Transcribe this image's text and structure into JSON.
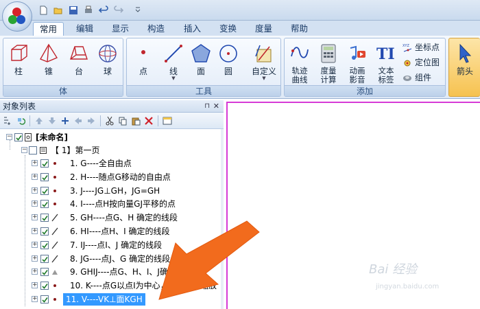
{
  "quick_access": [
    "new-icon",
    "open-icon",
    "save-icon",
    "print-icon",
    "undo-icon",
    "redo-icon",
    "customize-icon"
  ],
  "tabs": [
    {
      "label": "常用",
      "active": true
    },
    {
      "label": "编辑"
    },
    {
      "label": "显示"
    },
    {
      "label": "构造"
    },
    {
      "label": "插入"
    },
    {
      "label": "变换"
    },
    {
      "label": "度量"
    },
    {
      "label": "帮助"
    }
  ],
  "ribbon": {
    "solid_group": {
      "label": "体",
      "buttons": [
        "柱",
        "锥",
        "台",
        "球"
      ]
    },
    "tool_group": {
      "label": "工具",
      "buttons": [
        "点",
        "线",
        "面",
        "圆"
      ],
      "custom": "自定义"
    },
    "add_group": {
      "label": "添加",
      "buttons": [
        [
          "轨迹",
          "曲线"
        ],
        [
          "度量",
          "计算"
        ],
        [
          "动画",
          "影音"
        ],
        [
          "文本",
          "标签"
        ]
      ],
      "small": [
        "坐标点",
        "定位图",
        "组件"
      ]
    },
    "arrow_button": "箭头"
  },
  "panel": {
    "title": "对象列表",
    "root": "[未命名]",
    "page": "【 1】第一页",
    "items": [
      {
        "text": "1. G----全自由点",
        "icon": "point"
      },
      {
        "text": "2. H----随点G移动的自由点",
        "icon": "point"
      },
      {
        "text": "3. J----JG⊥GH，JG=GH",
        "icon": "point"
      },
      {
        "text": "4. I----点H按向量GJ平移的点",
        "icon": "point"
      },
      {
        "text": "5. GH----点G、H 确定的线段",
        "icon": "segment"
      },
      {
        "text": "6. HI----点H、I 确定的线段",
        "icon": "segment"
      },
      {
        "text": "7. IJ----点I、J 确定的线段",
        "icon": "segment"
      },
      {
        "text": "8. JG----点J、G 确定的线段",
        "icon": "segment"
      },
      {
        "text": "9. GHIJ----点G、H、I、J确定",
        "icon": "polygon"
      },
      {
        "text": "10. K----点G以点I为中心，按.5000缩放",
        "icon": "point"
      },
      {
        "text": "11. V----VK⊥面KGH",
        "icon": "point",
        "selected": true
      }
    ]
  },
  "watermark": {
    "main": "Bai 经验",
    "sub": "jingyan.baidu.com"
  },
  "colors": {
    "accent": "#3399ff",
    "canvas_border": "#d63ad6",
    "arrow": "#f26b1d"
  }
}
